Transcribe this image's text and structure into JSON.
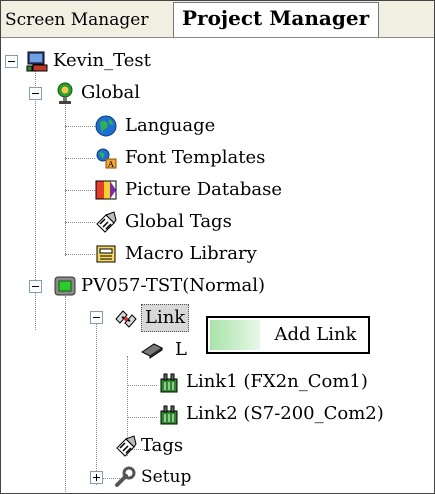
{
  "tabs": [
    {
      "label": "Screen Manager"
    },
    {
      "label": "Project Manager"
    }
  ],
  "tree": {
    "project": "Kevin_Test",
    "global": {
      "label": "Global",
      "children": [
        "Language",
        "Font Templates",
        "Picture Database",
        "Global Tags",
        "Macro Library"
      ]
    },
    "device": {
      "label": "PV057-TST(Normal)",
      "link": {
        "label": "Link",
        "children": [
          "L",
          "Link1 (FX2n_Com1)",
          "Link2 (S7-200_Com2)"
        ]
      },
      "tags": "Tags",
      "setup": "Setup"
    }
  },
  "context_menu": {
    "item": "Add Link"
  },
  "icons": {
    "project": "project-icon",
    "global": "globe-person-icon",
    "language": "earth-icon",
    "font_templates": "font-templates-icon",
    "picture_database": "picture-database-icon",
    "global_tags": "tags-icon",
    "macro_library": "macro-library-icon",
    "device": "device-icon",
    "link": "link-icon",
    "link_local": "chip-icon",
    "link_port": "port-icon",
    "tags": "tags-icon",
    "setup": "setup-icon"
  },
  "colors": {
    "menu_highlight": "#a9e3a9",
    "tab_bg": "#f1efe2"
  }
}
